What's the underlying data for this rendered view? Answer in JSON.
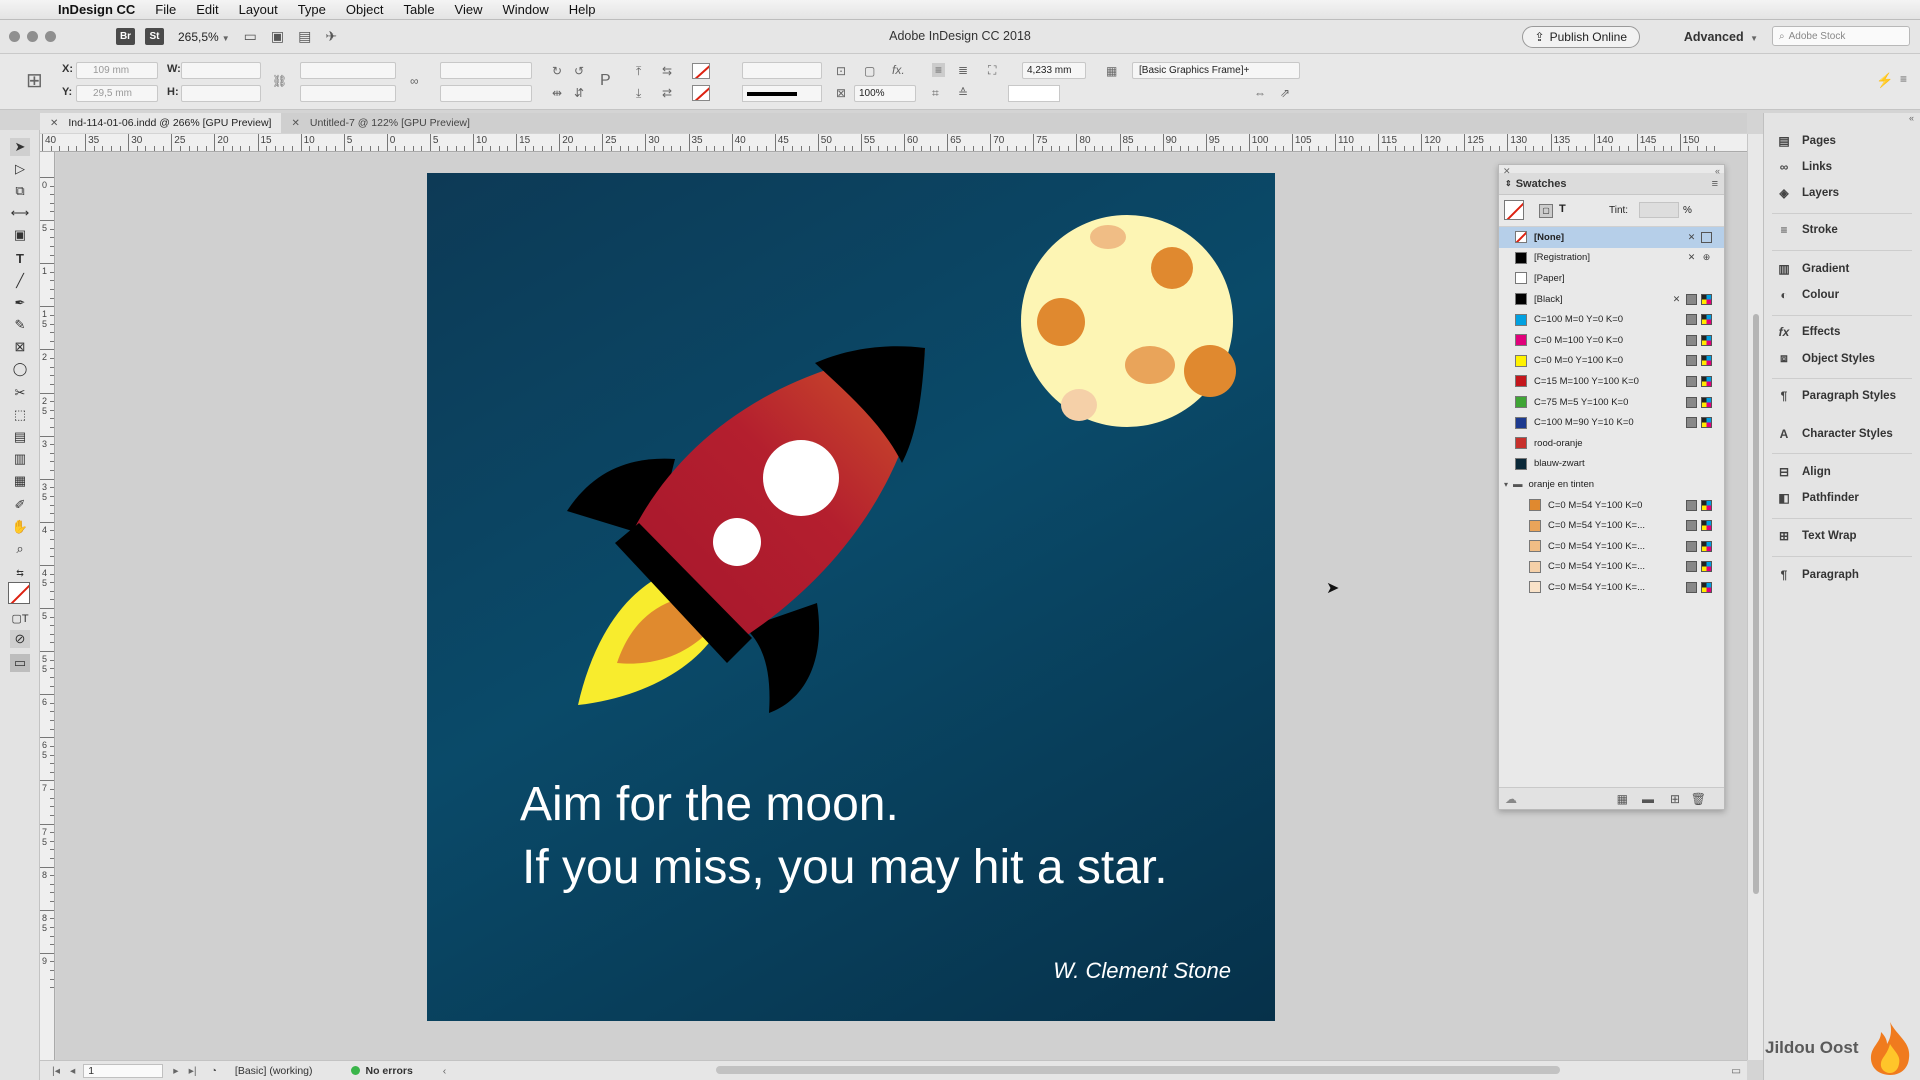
{
  "menubar": {
    "app_name": "InDesign CC",
    "items": [
      "File",
      "Edit",
      "Layout",
      "Type",
      "Object",
      "Table",
      "View",
      "Window",
      "Help"
    ]
  },
  "titlebar": {
    "br_badge": "Br",
    "st_badge": "St",
    "zoom": "265,5%",
    "window_title": "Adobe InDesign CC 2018",
    "publish_label": "Publish Online",
    "workspace": "Advanced",
    "stock_placeholder": "Adobe Stock"
  },
  "control": {
    "x_label": "X:",
    "y_label": "Y:",
    "w_label": "W:",
    "h_label": "H:",
    "x_value": "109 mm",
    "y_value": "29,5 mm",
    "stroke_weight": "4,233 mm",
    "opacity": "100%",
    "object_style": "[Basic Graphics Frame]+"
  },
  "tabs": [
    {
      "label": "Ind-114-01-06.indd @ 266% [GPU Preview]",
      "active": true
    },
    {
      "label": "Untitled-7 @ 122% [GPU Preview]",
      "active": false
    }
  ],
  "ruler": {
    "h_labels": [
      "40",
      "35",
      "30",
      "25",
      "20",
      "15",
      "10",
      "5",
      "0",
      "5",
      "10",
      "15",
      "20",
      "25",
      "30",
      "35",
      "40",
      "45",
      "50",
      "55",
      "60",
      "65",
      "70",
      "75",
      "80",
      "85",
      "90",
      "95",
      "100",
      "105",
      "110",
      "115",
      "120",
      "125",
      "130",
      "135",
      "140",
      "145",
      "150"
    ],
    "v_labels": [
      "0",
      "5",
      "1",
      "1 5",
      "2",
      "2 5",
      "3",
      "3 5",
      "4",
      "4 5",
      "5",
      "5 5",
      "6",
      "6 5",
      "7",
      "7 5",
      "8",
      "8 5",
      "9"
    ]
  },
  "artwork": {
    "quote_line1": "Aim for the moon.",
    "quote_line2": "If you miss, you may hit a star.",
    "author": "W. Clement Stone",
    "colors": {
      "bg_dark": "#06314a",
      "bg_mid": "#0a4a69",
      "rocket_red": "#b01c2e",
      "rocket_orange": "#c9522a",
      "moon": "#fdf5b4",
      "crater": "#e0892f",
      "flame_yellow": "#f8ec2d",
      "flame_orange": "#e08a2e"
    }
  },
  "swatches": {
    "title": "Swatches",
    "tint_label": "Tint:",
    "tint_unit": "%",
    "items": [
      {
        "name": "[None]",
        "color": "none",
        "selected": true
      },
      {
        "name": "[Registration]",
        "color": "#000000"
      },
      {
        "name": "[Paper]",
        "color": "#ffffff"
      },
      {
        "name": "[Black]",
        "color": "#000000"
      },
      {
        "name": "C=100 M=0 Y=0 K=0",
        "color": "#00a0e0"
      },
      {
        "name": "C=0 M=100 Y=0 K=0",
        "color": "#e0007a"
      },
      {
        "name": "C=0 M=0 Y=100 K=0",
        "color": "#fff200"
      },
      {
        "name": "C=15 M=100 Y=100 K=0",
        "color": "#c4161c"
      },
      {
        "name": "C=75 M=5 Y=100 K=0",
        "color": "#3fa535"
      },
      {
        "name": "C=100 M=90 Y=10 K=0",
        "color": "#1d3a8f"
      },
      {
        "name": "rood-oranje",
        "color": "#c7302b"
      },
      {
        "name": "blauw-zwart",
        "color": "#0a2838"
      }
    ],
    "group_name": "oranje en tinten",
    "group_items": [
      {
        "name": "C=0 M=54 Y=100 K=0",
        "color": "#e0892f"
      },
      {
        "name": "C=0 M=54 Y=100 K=...",
        "color": "#e9a45a"
      },
      {
        "name": "C=0 M=54 Y=100 K=...",
        "color": "#f0bd85"
      },
      {
        "name": "C=0 M=54 Y=100 K=...",
        "color": "#f5d0a8"
      },
      {
        "name": "C=0 M=54 Y=100 K=...",
        "color": "#f9e2c8"
      }
    ]
  },
  "dock": {
    "items": [
      {
        "label": "Pages",
        "icon": "pages-icon"
      },
      {
        "label": "Links",
        "icon": "links-icon"
      },
      {
        "label": "Layers",
        "icon": "layers-icon"
      },
      {
        "label": "Stroke",
        "icon": "stroke-icon"
      },
      {
        "label": "Gradient",
        "icon": "gradient-icon"
      },
      {
        "label": "Colour",
        "icon": "colour-icon"
      },
      {
        "label": "Effects",
        "icon": "effects-icon"
      },
      {
        "label": "Object Styles",
        "icon": "object-styles-icon"
      },
      {
        "label": "Paragraph Styles",
        "icon": "paragraph-styles-icon"
      },
      {
        "label": "Character Styles",
        "icon": "character-styles-icon"
      },
      {
        "label": "Align",
        "icon": "align-icon"
      },
      {
        "label": "Pathfinder",
        "icon": "pathfinder-icon"
      },
      {
        "label": "Text Wrap",
        "icon": "text-wrap-icon"
      },
      {
        "label": "Paragraph",
        "icon": "paragraph-icon"
      }
    ]
  },
  "status": {
    "page": "1",
    "style": "[Basic] (working)",
    "errors": "No errors"
  },
  "watermark": "Jildou Oost"
}
